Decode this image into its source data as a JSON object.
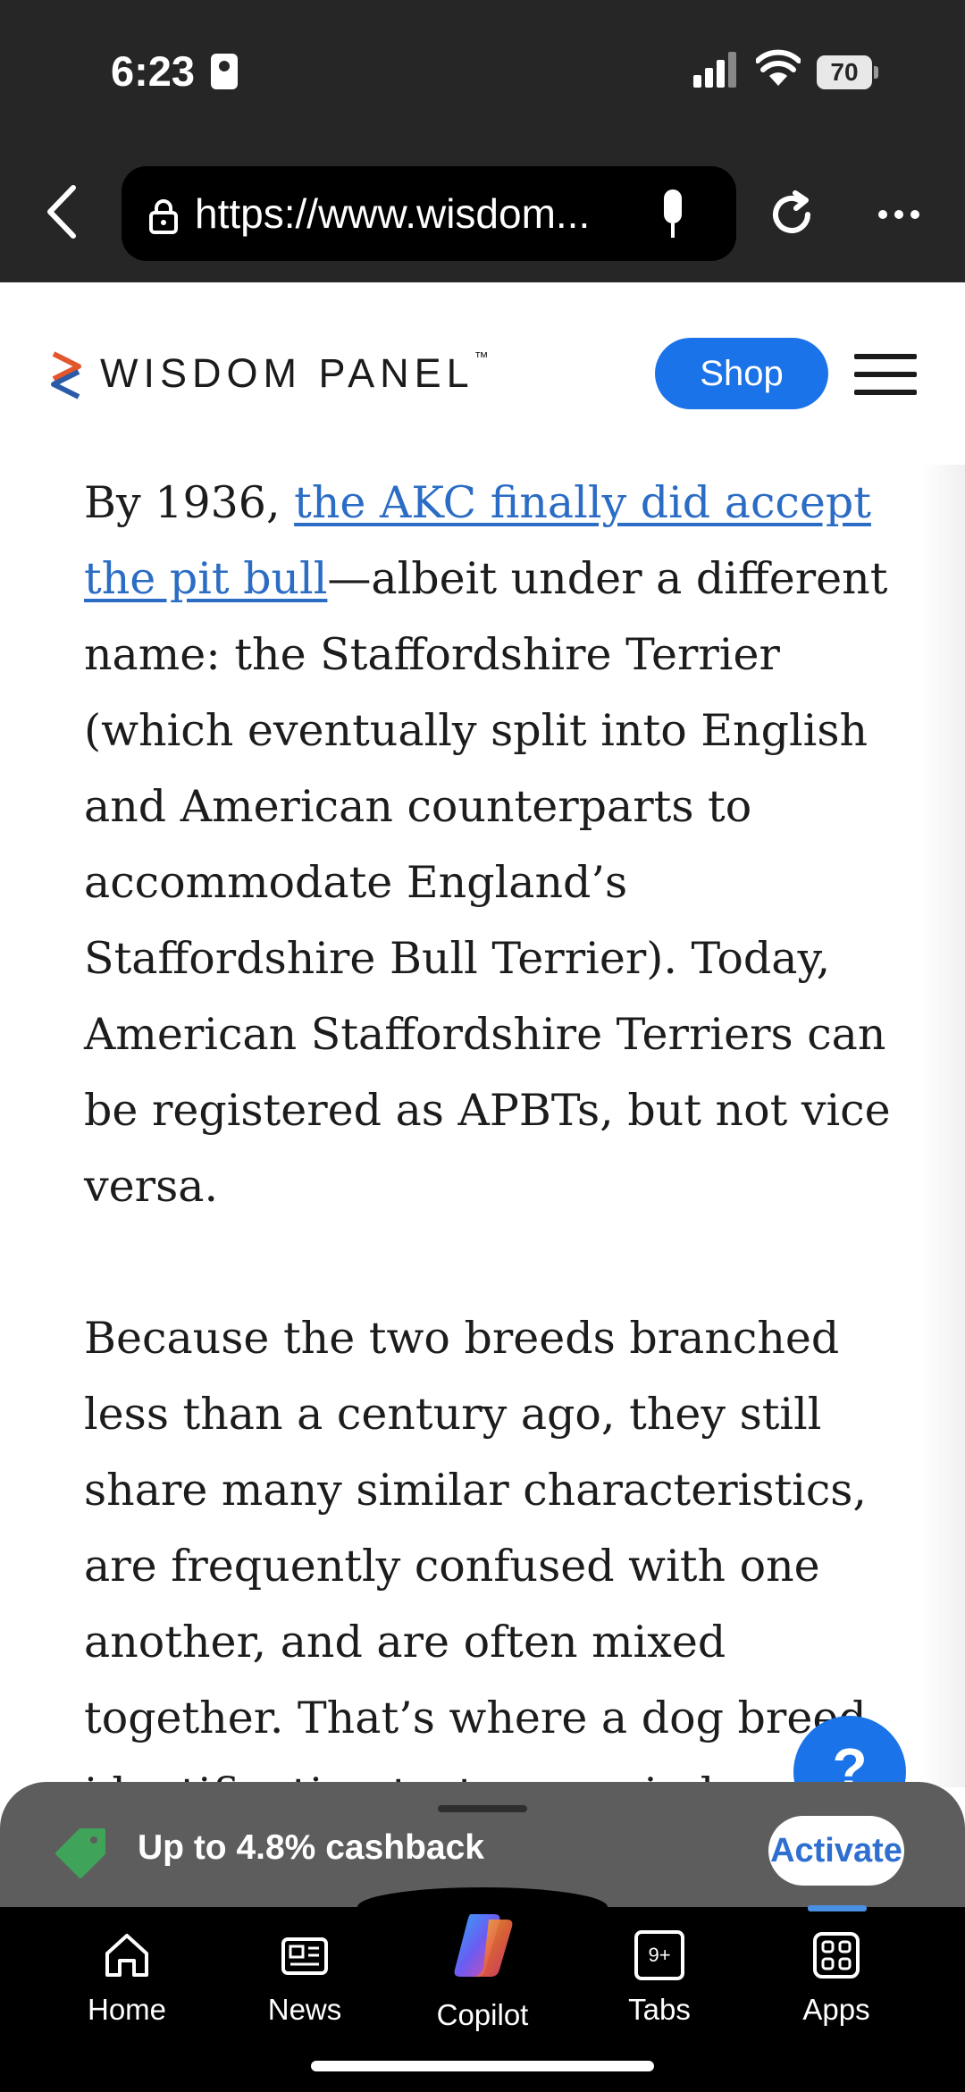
{
  "status_bar": {
    "time": "6:23",
    "battery": "70"
  },
  "browser": {
    "url": "https://www.wisdom..."
  },
  "site": {
    "brand": "WISDOM PANEL",
    "trademark": "™",
    "shop_label": "Shop"
  },
  "article": {
    "p1_prefix": "By 1936, ",
    "p1_link": "the AKC finally did accept the pit bull",
    "p1_rest": "—albeit under a different name: the Staffordshire Terrier (which eventually split into English and American counterparts to accommodate England’s Staffordshire Bull Terrier). Today, American Staffordshire Terriers can be registered as APBTs, but not vice versa.",
    "p2": "Because the two breeds branched less than a century ago, they still share many similar characteristics, are frequently confused with one another, and are often mixed together. That’s where a dog breed identification test comes in handy."
  },
  "help": {
    "label": "?"
  },
  "cashback": {
    "text": "Up to 4.8% cashback",
    "activate_label": "Activate"
  },
  "nav": {
    "home": "Home",
    "news": "News",
    "copilot": "Copilot",
    "tabs": "Tabs",
    "tabs_badge": "9+",
    "apps": "Apps"
  },
  "colors": {
    "accent": "#1a73e8",
    "link": "#2b6cc4",
    "chrome": "#262626",
    "sheet": "#5d5d5d"
  }
}
